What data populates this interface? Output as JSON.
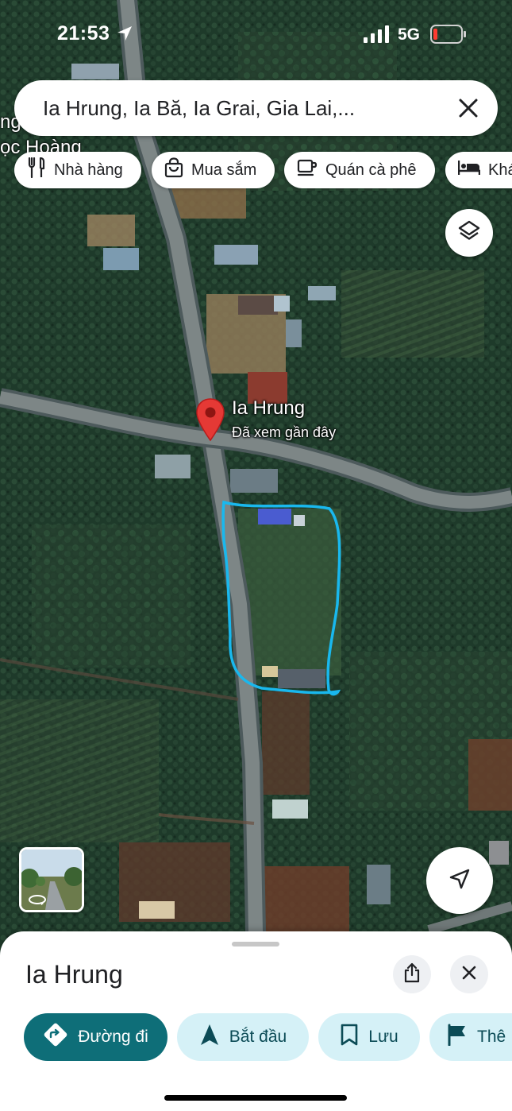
{
  "status_bar": {
    "time": "21:53",
    "network": "5G",
    "location_icon": "location-arrow-icon",
    "signal_icon": "signal-bars-icon",
    "battery_icon": "battery-low-icon",
    "battery_color": "#ff3b30"
  },
  "search": {
    "query": "Ia Hrung, Ia Bă, Ia Grai, Gia Lai,..."
  },
  "map_labels": {
    "place_partial_1": "ng",
    "place_partial_2": "ọc Hoàng"
  },
  "chips": [
    {
      "label": "Nhà hàng",
      "icon": "fork-knife-icon"
    },
    {
      "label": "Mua sắm",
      "icon": "shopping-bag-icon"
    },
    {
      "label": "Quán cà phê",
      "icon": "coffee-cup-icon"
    },
    {
      "label": "Khá",
      "icon": "bed-icon"
    }
  ],
  "pin": {
    "title": "Ia Hrung",
    "subtitle": "Đã xem gần đây",
    "color": "#e53935"
  },
  "sheet": {
    "title": "Ia Hrung",
    "actions": [
      {
        "label": "Đường đi",
        "icon": "directions-icon"
      },
      {
        "label": "Bắt đầu",
        "icon": "navigation-arrow-icon"
      },
      {
        "label": "Lưu",
        "icon": "bookmark-icon"
      },
      {
        "label": "Thê",
        "icon": "flag-icon"
      }
    ]
  },
  "colors": {
    "primary_action": "#0e6e78",
    "secondary_action": "#d5f1f7",
    "drawn_outline": "#19b8ee"
  }
}
